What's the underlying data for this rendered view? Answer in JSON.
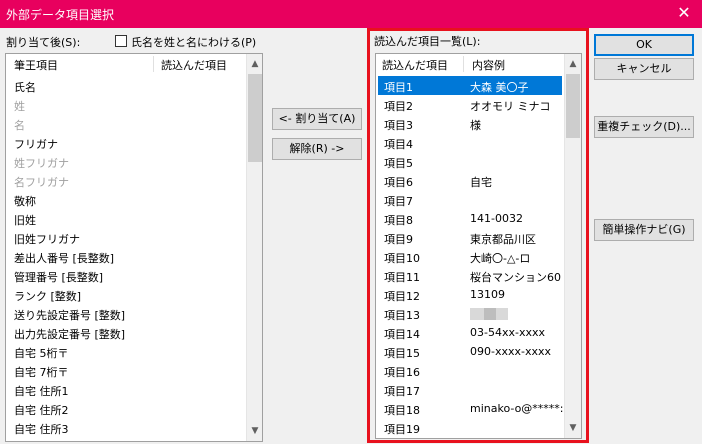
{
  "window": {
    "title": "外部データ項目選択",
    "close_glyph": "✕"
  },
  "left": {
    "label": "割り当て後(S):",
    "split_name_label": "氏名を姓と名にわける(P)",
    "columns": [
      "筆王項目",
      "読込んだ項目"
    ],
    "items": [
      {
        "label": "氏名",
        "disabled": false
      },
      {
        "label": "姓",
        "disabled": true
      },
      {
        "label": "名",
        "disabled": true
      },
      {
        "label": "フリガナ",
        "disabled": false
      },
      {
        "label": "姓フリガナ",
        "disabled": true
      },
      {
        "label": "名フリガナ",
        "disabled": true
      },
      {
        "label": "敬称",
        "disabled": false
      },
      {
        "label": "旧姓",
        "disabled": false
      },
      {
        "label": "旧姓フリガナ",
        "disabled": false
      },
      {
        "label": "差出人番号 [長整数]",
        "disabled": false
      },
      {
        "label": "管理番号 [長整数]",
        "disabled": false
      },
      {
        "label": "ランク [整数]",
        "disabled": false
      },
      {
        "label": "送り先設定番号 [整数]",
        "disabled": false
      },
      {
        "label": "出力先設定番号 [整数]",
        "disabled": false
      },
      {
        "label": "自宅 5桁〒",
        "disabled": false
      },
      {
        "label": "自宅 7桁〒",
        "disabled": false
      },
      {
        "label": "自宅 住所1",
        "disabled": false
      },
      {
        "label": "自宅 住所2",
        "disabled": false
      },
      {
        "label": "自宅 住所3",
        "disabled": false
      }
    ]
  },
  "middle": {
    "assign_label": "<- 割り当て(A)",
    "remove_label": "解除(R) ->"
  },
  "right": {
    "label": "読込んだ項目一覧(L):",
    "columns": [
      "読込んだ項目",
      "内容例"
    ],
    "items": [
      {
        "name": "項目1",
        "value": "大森 美〇子",
        "selected": true
      },
      {
        "name": "項目2",
        "value": "オオモリ ミナコ"
      },
      {
        "name": "項目3",
        "value": "様"
      },
      {
        "name": "項目4",
        "value": ""
      },
      {
        "name": "項目5",
        "value": ""
      },
      {
        "name": "項目6",
        "value": "自宅"
      },
      {
        "name": "項目7",
        "value": ""
      },
      {
        "name": "項目8",
        "value": "141-0032"
      },
      {
        "name": "項目9",
        "value": "東京都品川区"
      },
      {
        "name": "項目10",
        "value": "大崎〇-△-ロ"
      },
      {
        "name": "項目11",
        "value": "桜台マンション60"
      },
      {
        "name": "項目12",
        "value": "13109"
      },
      {
        "name": "項目13",
        "value": "",
        "masked": true
      },
      {
        "name": "項目14",
        "value": "03-54xx-xxxx"
      },
      {
        "name": "項目15",
        "value": "090-xxxx-xxxx"
      },
      {
        "name": "項目16",
        "value": ""
      },
      {
        "name": "項目17",
        "value": ""
      },
      {
        "name": "項目18",
        "value": "minako-o@*****:"
      },
      {
        "name": "項目19",
        "value": ""
      }
    ]
  },
  "buttons": {
    "ok": "OK",
    "cancel": "キャンセル",
    "duplicate_check": "重複チェック(D)...",
    "simple_navi": "簡単操作ナビ(G)"
  }
}
